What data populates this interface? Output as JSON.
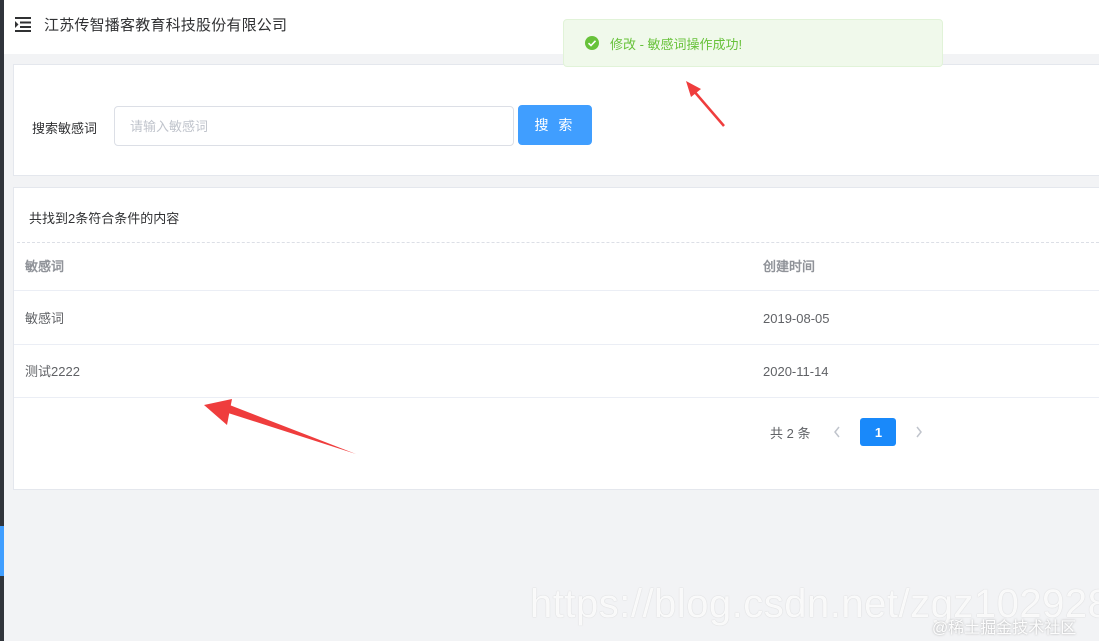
{
  "header": {
    "company_name": "江苏传智播客教育科技股份有限公司"
  },
  "toast": {
    "message": "修改 - 敏感词操作成功!",
    "color": "#67c23a"
  },
  "search": {
    "label": "搜索敏感词",
    "placeholder": "请输入敏感词",
    "value": "",
    "button_label": "搜 索"
  },
  "results": {
    "summary": "共找到2条符合条件的内容",
    "columns": [
      "敏感词",
      "创建时间"
    ],
    "rows": [
      {
        "word": "敏感词",
        "created": "2019-08-05"
      },
      {
        "word": "测试2222",
        "created": "2020-11-14"
      }
    ]
  },
  "pagination": {
    "total_text": "共 2 条",
    "current_page": "1",
    "prev_icon": "chevron-left-icon",
    "next_icon": "chevron-right-icon"
  },
  "watermarks": {
    "url": "https://blog.csdn.net/zgz102928",
    "juejin": "@稀土掘金技术社区"
  },
  "colors": {
    "primary": "#409eff",
    "success": "#67c23a",
    "annotation": "#ef3d3d"
  }
}
